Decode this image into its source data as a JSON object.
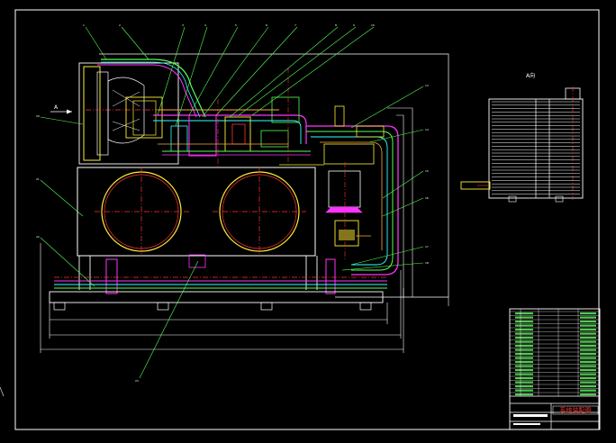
{
  "drawing": {
    "view_label": "A向",
    "section_marker": "A",
    "title_block_name": "系统装配图",
    "colors": {
      "background": "#000000",
      "frame": "#ffffff",
      "green_pipe": "#55ff55",
      "magenta": "#ff33ff",
      "cyan": "#33ffff",
      "yellow": "#ffee33",
      "red": "#ff3333",
      "orange": "#ffaa33"
    },
    "leader_numbers_top": [
      "1",
      "2",
      "3",
      "4",
      "5",
      "6",
      "7",
      "8",
      "9",
      "10",
      "11",
      "12"
    ],
    "leader_numbers_right": [
      "13",
      "14",
      "15",
      "16",
      "17",
      "18",
      "19"
    ],
    "leader_numbers_left": [
      "20",
      "21",
      "22"
    ],
    "leader_number_bottom": "23",
    "dimension_labels": [
      "",
      "",
      "",
      "",
      ""
    ]
  }
}
